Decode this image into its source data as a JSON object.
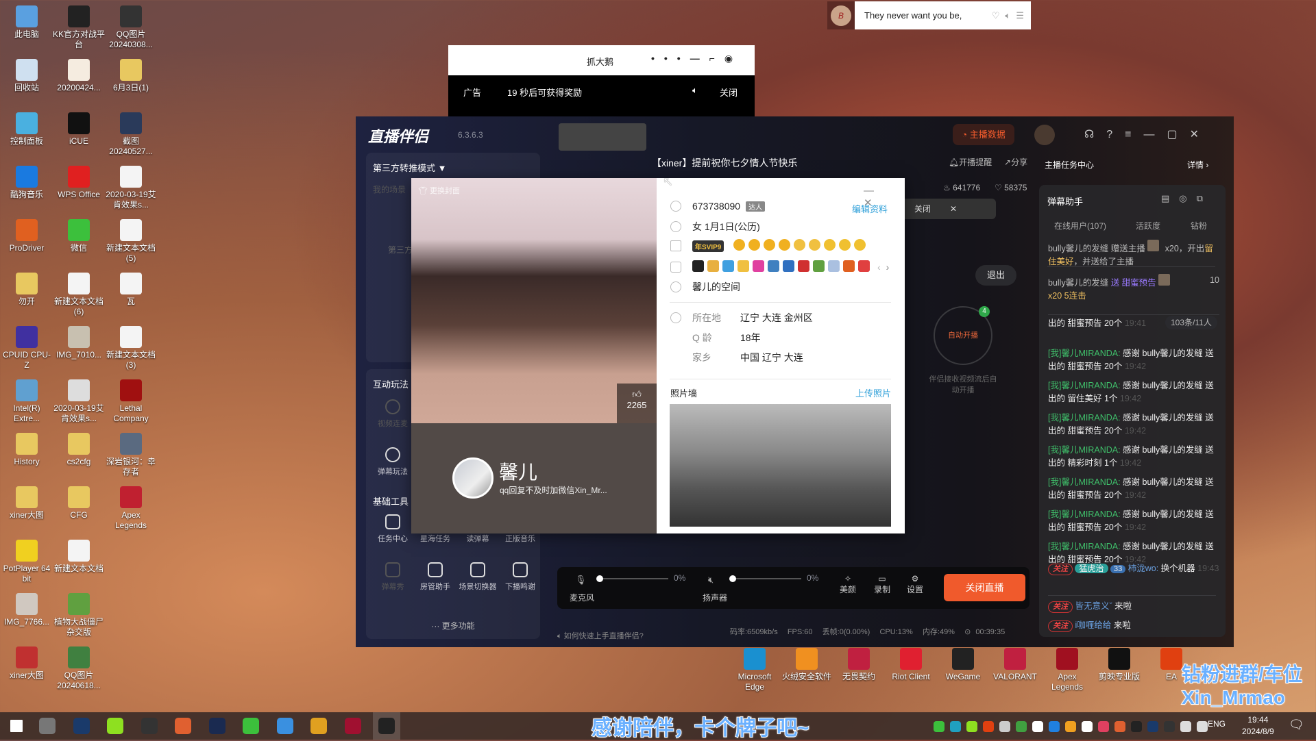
{
  "desktop_icons": [
    {
      "label": "此电脑",
      "color": "#5aa0e0"
    },
    {
      "label": "KK官方对战平台",
      "color": "#222"
    },
    {
      "label": "QQ图片20240308...",
      "color": "#333"
    },
    {
      "label": "回收站",
      "color": "#cfe0f0"
    },
    {
      "label": "20200424...",
      "color": "#f5ece0"
    },
    {
      "label": "6月3日(1)",
      "color": "#e8c860"
    },
    {
      "label": "控制面板",
      "color": "#4ab0e0"
    },
    {
      "label": "iCUE",
      "color": "#111"
    },
    {
      "label": "截图20240527...",
      "color": "#2a3a5a"
    },
    {
      "label": "酷狗音乐",
      "color": "#1a7ae0"
    },
    {
      "label": "WPS Office",
      "color": "#e02020"
    },
    {
      "label": "2020-03-19艾肯效果s...",
      "color": "#f4f4f4"
    },
    {
      "label": "ProDriver",
      "color": "#e06020"
    },
    {
      "label": "微信",
      "color": "#3cc03c"
    },
    {
      "label": "新建文本文档(5)",
      "color": "#f4f4f4"
    },
    {
      "label": "勿开",
      "color": "#e8c860"
    },
    {
      "label": "新建文本文档(6)",
      "color": "#f4f4f4"
    },
    {
      "label": "瓦",
      "color": "#f4f4f4"
    },
    {
      "label": "CPUID CPU-Z",
      "color": "#4030a0"
    },
    {
      "label": "IMG_7010...",
      "color": "#c8c0b0"
    },
    {
      "label": "新建文本文档(3)",
      "color": "#f4f4f4"
    },
    {
      "label": "Intel(R) Extre...",
      "color": "#60a0d0"
    },
    {
      "label": "2020-03-19艾肯效果s...",
      "color": "#ddd"
    },
    {
      "label": "Lethal Company",
      "color": "#a01010"
    },
    {
      "label": "History",
      "color": "#e8c860"
    },
    {
      "label": "cs2cfg",
      "color": "#e8c860"
    },
    {
      "label": "深岩银河：幸存者",
      "color": "#5a6a80"
    },
    {
      "label": "xiner大图",
      "color": "#e8c860"
    },
    {
      "label": "CFG",
      "color": "#e8c860"
    },
    {
      "label": "Apex Legends",
      "color": "#c02030"
    },
    {
      "label": "PotPlayer 64 bit",
      "color": "#f0d020"
    },
    {
      "label": "新建文本文档",
      "color": "#f4f4f4"
    },
    {
      "label": "",
      "color": ""
    },
    {
      "label": "IMG_7766...",
      "color": "#d0c8c0"
    },
    {
      "label": "植物大战僵尸杂交版",
      "color": "#60a040"
    },
    {
      "label": "",
      "color": ""
    },
    {
      "label": "xiner大图",
      "color": "#c03030"
    },
    {
      "label": "QQ图片20240618...",
      "color": "#408040"
    },
    {
      "label": "",
      "color": ""
    }
  ],
  "desktop_icons_bottom": [
    {
      "label": "Microsoft Edge",
      "color": "#1a90d0"
    },
    {
      "label": "火绒安全软件",
      "color": "#f09020"
    },
    {
      "label": "无畏契约",
      "color": "#c02040"
    },
    {
      "label": "Riot Client",
      "color": "#e02030"
    },
    {
      "label": "WeGame",
      "color": "#222"
    },
    {
      "label": "VALORANT",
      "color": "#c02040"
    },
    {
      "label": "Apex Legends",
      "color": "#a01020"
    },
    {
      "label": "剪映专业版",
      "color": "#111"
    },
    {
      "label": "EA",
      "color": "#e04010"
    }
  ],
  "music_player": {
    "lyric": "They never want you be,",
    "cover_letter": "B"
  },
  "ad_window": {
    "title": "抓大鹅",
    "ad_label": "广告",
    "countdown": "19 秒后可获得奖励",
    "close": "关闭"
  },
  "app": {
    "name": "直播伴侣",
    "version": "6.3.6.3",
    "anchor_data": "主播数据",
    "stream_title": "【xiner】提前祝你七夕情人节快乐",
    "remind": "开播提醒",
    "share": "分享",
    "heat": "641776",
    "likes": "58375",
    "mode": "第三方转推模式 ▼",
    "my_scene": "我的场景",
    "third_party_hint": "第三方",
    "interactive_title": "互动玩法",
    "video_link": "视频连麦",
    "danmu_play": "弹幕玩法",
    "basic_title": "基础工具",
    "tools": [
      "任务中心",
      "星海任务",
      "读弹幕",
      "正版音乐",
      "弹幕秀",
      "房管助手",
      "场景切换器",
      "下播鸣谢"
    ],
    "more": "··· 更多功能",
    "notice_close": "关闭",
    "exit": "退出",
    "auto_start": "自动开播",
    "auto_badge": "4",
    "auto_hint": "伴侣接收视频流后自动开播",
    "mic_label": "麦克风",
    "mic_value": "0%",
    "speaker_label": "扬声器",
    "speaker_value": "0%",
    "mic_level": 0,
    "speaker_level": 0,
    "beauty": "美颜",
    "record": "录制",
    "settings": "设置",
    "stop_live": "关闭直播",
    "help": "如何快速上手直播伴侣?",
    "status": {
      "bitrate": "码率:6509kb/s",
      "fps": "FPS:60",
      "drop": "丢帧:0(0.00%)",
      "cpu": "CPU:13%",
      "mem": "内存:49%",
      "duration": "00:39:35"
    },
    "task_center": "主播任务中心",
    "details": "详情 ›",
    "danmu_title": "弹幕助手",
    "tabs": [
      "在线用户(107)",
      "活跃度",
      "钻粉"
    ],
    "gift1": {
      "user": "bully馨儿的发缝",
      "text1": " 赠送主播 ",
      "count": " x20，开出",
      "item": "留住美好",
      "text2": "，并送给了主播"
    },
    "gift2": {
      "user": "bully馨儿的发缝",
      "text": " 送 甜蜜预告",
      "fans": "10",
      "combo": "x20  5连击"
    },
    "msg_count": "103条/11人",
    "messages": [
      {
        "prefix": "",
        "text": "出的 甜蜜预告 20个",
        "time": "19:41"
      },
      {
        "prefix": "[我]馨儿MIRANDA:",
        "text": " 感谢 bully馨儿的发缝 送出的 甜蜜预告 20个",
        "time": "19:42"
      },
      {
        "prefix": "[我]馨儿MIRANDA:",
        "text": " 感谢 bully馨儿的发缝 送出的 留住美好 1个",
        "time": "19:42"
      },
      {
        "prefix": "[我]馨儿MIRANDA:",
        "text": " 感谢 bully馨儿的发缝 送出的 甜蜜预告 20个",
        "time": "19:42"
      },
      {
        "prefix": "[我]馨儿MIRANDA:",
        "text": " 感谢 bully馨儿的发缝 送出的 精彩时刻 1个",
        "time": "19:42"
      },
      {
        "prefix": "[我]馨儿MIRANDA:",
        "text": " 感谢 bully馨儿的发缝 送出的 甜蜜预告 20个",
        "time": "19:42"
      },
      {
        "prefix": "[我]馨儿MIRANDA:",
        "text": " 感谢 bully馨儿的发缝 送出的 甜蜜预告 20个",
        "time": "19:42"
      },
      {
        "prefix": "[我]馨儿MIRANDA:",
        "text": " 感谢 bully馨儿的发缝 送出的 甜蜜预告 20个",
        "time": "19:42"
      }
    ],
    "follow_label": "关注",
    "last_msg": {
      "fan_badge": "猛虎治",
      "level": "33",
      "user": "柿泷wo:",
      "text": " 换个机器",
      "time": "19:43"
    },
    "enters": [
      {
        "user": "皆无意义ˇ",
        "text": " 来啦"
      },
      {
        "user": "i咖喱给给",
        "text": " 来啦"
      }
    ]
  },
  "profile": {
    "change_cover": "更换封面",
    "likes": "2265",
    "name": "馨儿",
    "signature": "qq回复不及时加微信Xin_Mr...",
    "qq": "673738090",
    "talent": "达人",
    "edit": "编辑资料",
    "gender_birthday": "女   1月1日(公历)",
    "vip": "年SVIP9",
    "space": "馨儿的空间",
    "fields": [
      {
        "label": "所在地",
        "value": "辽宁 大连 金州区"
      },
      {
        "label": "Q 龄",
        "value": "18年"
      },
      {
        "label": "家乡",
        "value": "中国 辽宁 大连"
      }
    ],
    "photo_wall": "照片墙",
    "upload": "上传照片"
  },
  "overlay": {
    "line1": "钻粉进群/车位",
    "line2": "Xin_Mrmao",
    "bottom": "感谢陪伴，卡个牌子吧~"
  },
  "taskbar": {
    "apps": [
      "start",
      "file-explorer",
      "steam",
      "kook",
      "obs",
      "xiaohongshu",
      "icue",
      "wechat",
      "qq-browser",
      "chrome",
      "apex",
      "qq"
    ],
    "lang": "ENG",
    "time": "19:44",
    "date": "2024/8/9"
  },
  "colors": {
    "accent": "#f05a2c",
    "link": "#2b9ed8",
    "green": "#3fbf6a"
  }
}
